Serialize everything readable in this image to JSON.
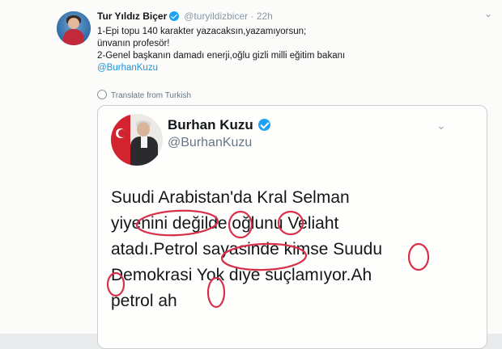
{
  "tweet": {
    "author_name": "Tur Yıldız Biçer",
    "handle": "@turyildizbicer",
    "separator": "·",
    "time": "22h",
    "lines": [
      "1-Epi topu 140 karakter yazacaksın,yazamıyorsun;",
      "ünvanın profesör!",
      "2-Genel başkanın damadı enerji,oğlu gizli milli eğitim bakanı"
    ],
    "mention": "@BurhanKuzu",
    "translate_label": "Translate from Turkish"
  },
  "quoted": {
    "author_name": "Burhan Kuzu",
    "handle": "@BurhanKuzu",
    "text_lines": [
      "Suudi Arabistan'da Kral Selman",
      "yiyenini değilde oğlunu Veliaht",
      "atadı.Petrol sayasinde kimse Suudu",
      "Demokrasi Yok diye suçlamıyor.Ah",
      "petrol ah"
    ]
  },
  "colors": {
    "link": "#1b95e0",
    "verified": "#1da1f2",
    "annotation_red": "#d8304a"
  },
  "icons": [
    "verified-badge-icon",
    "chevron-down-icon",
    "globe-icon",
    "avatar"
  ]
}
